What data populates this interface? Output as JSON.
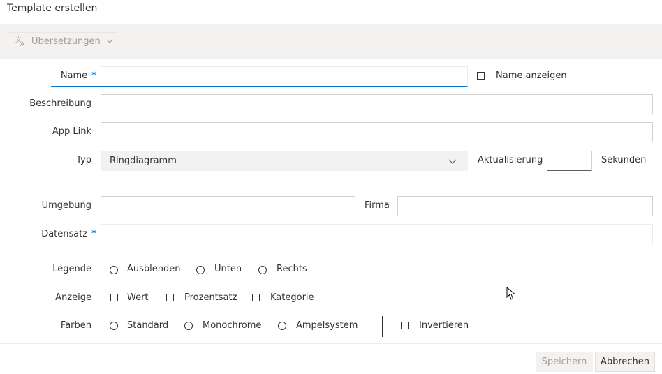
{
  "dialog": {
    "title": "Template erstellen"
  },
  "toolbar": {
    "translations_label": "Übersetzungen"
  },
  "form": {
    "name": {
      "label": "Name",
      "required_mark": "*",
      "value": ""
    },
    "show_name": {
      "label": "Name anzeigen",
      "checked": false
    },
    "description": {
      "label": "Beschreibung",
      "value": ""
    },
    "app_link": {
      "label": "App Link",
      "value": ""
    },
    "type": {
      "label": "Typ",
      "selected": "Ringdiagramm"
    },
    "refresh": {
      "label": "Aktualisierung",
      "value": "",
      "unit": "Sekunden"
    },
    "environment": {
      "label": "Umgebung",
      "value": ""
    },
    "company": {
      "label": "Firma",
      "value": ""
    },
    "dataset": {
      "label": "Datensatz",
      "required_mark": "*",
      "value": ""
    },
    "legend": {
      "label": "Legende",
      "options": [
        "Ausblenden",
        "Unten",
        "Rechts"
      ]
    },
    "display": {
      "label": "Anzeige",
      "options": [
        "Wert",
        "Prozentsatz",
        "Kategorie"
      ]
    },
    "colors": {
      "label": "Farben",
      "options": [
        "Standard",
        "Monochrome",
        "Ampelsystem"
      ],
      "invert_label": "Invertieren"
    }
  },
  "footer": {
    "save_label": "Speichern",
    "cancel_label": "Abbrechen"
  },
  "colors": {
    "accent": "#0078d4",
    "toolbar_bg": "#f3f2f1",
    "disabled_text": "#a19f9d"
  }
}
